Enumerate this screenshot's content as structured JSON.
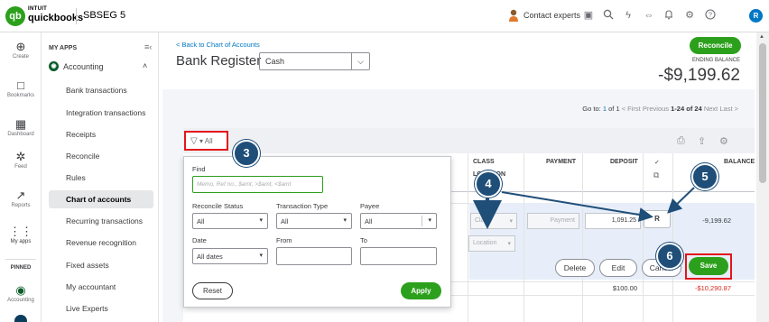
{
  "topbar": {
    "logo_mark": "qb",
    "brand_top": "INTUIT",
    "brand_main": "quickbooks",
    "company": "SBSEG 5",
    "contact_experts": "Contact experts",
    "avatar_initial": "R",
    "icons": [
      "clipboard-icon",
      "search-icon",
      "lightning-icon",
      "connect-icon",
      "bell-icon",
      "gear-icon",
      "help-icon"
    ]
  },
  "rail": {
    "items": [
      {
        "icon": "⊕",
        "label": "Create"
      },
      {
        "icon": "□",
        "label": "Bookmarks"
      },
      {
        "icon": "▦",
        "label": "Dashboard"
      },
      {
        "icon": "✲",
        "label": "Feed"
      },
      {
        "icon": "↗",
        "label": "Reports"
      },
      {
        "icon": "⋮⋮",
        "label": "My apps"
      }
    ],
    "pinned_label": "PINNED",
    "pinned_items": [
      {
        "icon": "◉",
        "label": "Accounting"
      }
    ]
  },
  "menu": {
    "section": "MY APPS",
    "app_name": "Accounting",
    "items": [
      "Bank transactions",
      "Integration transactions",
      "Receipts",
      "Reconcile",
      "Rules",
      "Chart of accounts",
      "Recurring transactions",
      "Revenue recognition",
      "Fixed assets",
      "My accountant",
      "Live Experts"
    ]
  },
  "main": {
    "back_link": "< Back to Chart of Accounts",
    "title": "Bank Register",
    "account": "Cash",
    "reconcile_label": "Reconcile",
    "ending_balance_label": "ENDING BALANCE",
    "ending_balance_value": "-$9,199.62"
  },
  "pager": {
    "goto": "Go to:",
    "page": "1",
    "of": "of",
    "total_pages": "1",
    "first": "< First",
    "previous": "Previous",
    "range": "1-24 of 24",
    "next": "Next",
    "last": "Last >"
  },
  "filter": {
    "button_label": "▾ All"
  },
  "table": {
    "headers": {
      "class": "CLASS",
      "location": "LOCATION",
      "payment": "PAYMENT",
      "deposit": "DEPOSIT",
      "check": "✓",
      "balance": "BALANCE"
    },
    "edit_row": {
      "class_placeholder": "Class",
      "location_placeholder": "Location",
      "payment_placeholder": "Payment",
      "deposit": "1,091.25",
      "reconcile_status": "R",
      "balance": "-9,199.62"
    },
    "buttons": {
      "delete": "Delete",
      "edit": "Edit",
      "cancel": "Cancel",
      "save": "Save"
    },
    "next_row": {
      "deposit": "$100.00",
      "balance": "-$10,290.87"
    }
  },
  "popup": {
    "find_label": "Find",
    "find_placeholder": "Memo, Ref no., $amt, >$amt, <$amt",
    "reconcile_status_label": "Reconcile Status",
    "reconcile_status_value": "All",
    "transaction_type_label": "Transaction Type",
    "transaction_type_value": "All",
    "payee_label": "Payee",
    "payee_value": "All",
    "date_label": "Date",
    "date_value": "All dates",
    "from_label": "From",
    "to_label": "To",
    "reset": "Reset",
    "apply": "Apply"
  },
  "steps": [
    "3",
    "4",
    "5",
    "6"
  ],
  "colors": {
    "brand_green": "#2ca01c",
    "link_blue": "#0077c5",
    "annotation_red": "#e4161c",
    "step_navy": "#1f4e79"
  }
}
